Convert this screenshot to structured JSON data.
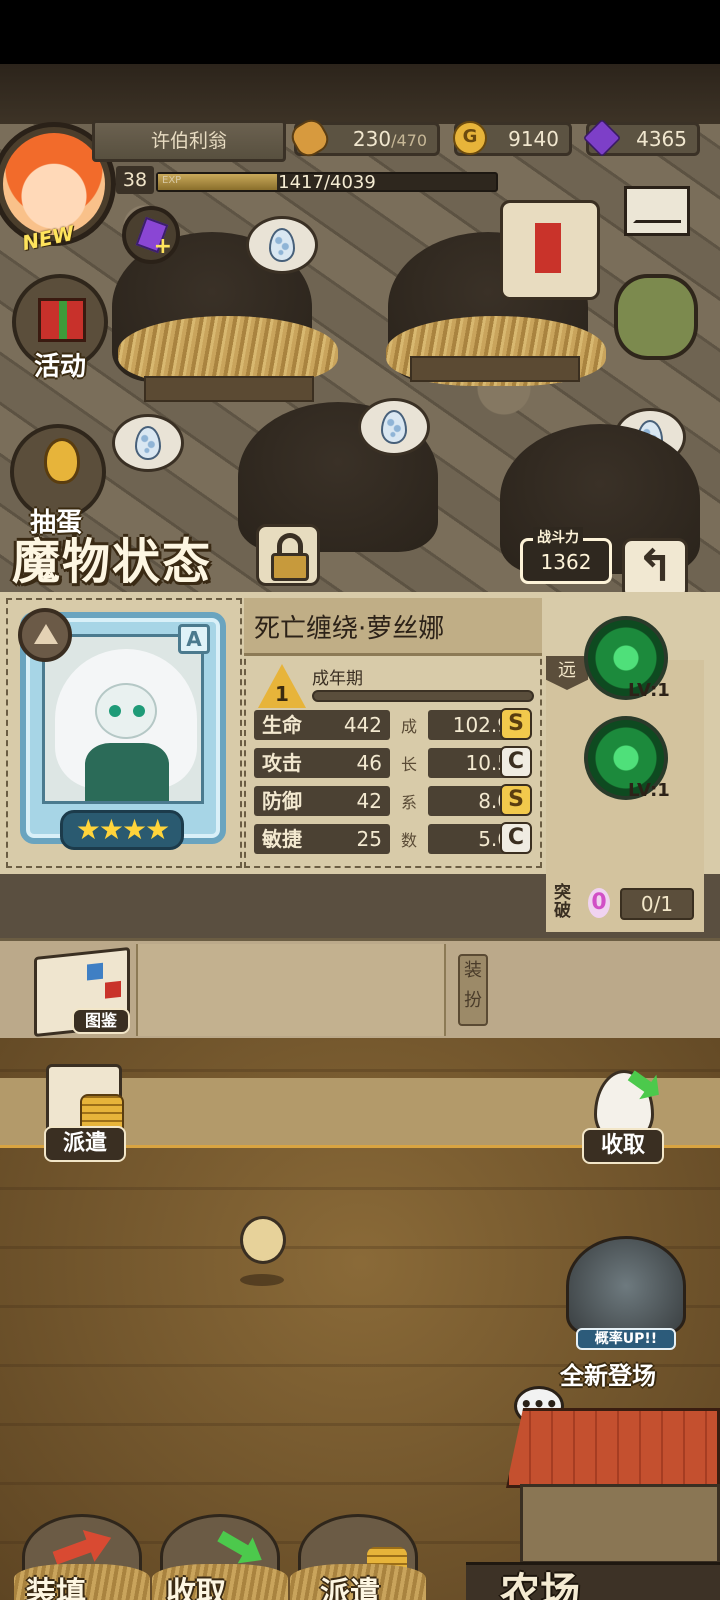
{
  "hud": {
    "player_name": "许伯利翁",
    "avatar_tag": "NEW",
    "level": "38",
    "exp_label": "EXP",
    "exp_text": "1417/4039",
    "exp_progress": 0.351,
    "food_current": "230",
    "food_max": "/470",
    "gold_icon_letter": "G",
    "gold": "9140",
    "gems": "4365"
  },
  "side": {
    "event_label": "活动",
    "egg_label": "抽蛋"
  },
  "panel": {
    "title": "魔物状态",
    "power_label": "战斗力",
    "power_value": "1362",
    "back_icon": "↰",
    "monster_name": "死亡缠绕·萝丝娜",
    "rank": "A",
    "stars": "★★★★",
    "star_count": 4,
    "stage_number": "1",
    "stage_name": "成年期",
    "growth_vertical": [
      "成",
      "长",
      "系",
      "数"
    ],
    "stats": [
      {
        "key": "生命",
        "value": "442",
        "growth": "102.9",
        "grade": "S"
      },
      {
        "key": "攻击",
        "value": "46",
        "growth": "10.5",
        "grade": "C"
      },
      {
        "key": "防御",
        "value": "42",
        "growth": "8.0",
        "grade": "S"
      },
      {
        "key": "敏捷",
        "value": "25",
        "growth": "5.6",
        "grade": "C"
      }
    ],
    "range": "远",
    "skills": [
      {
        "level": "LV:1"
      },
      {
        "level": "LV:1"
      }
    ],
    "breakthrough_label": "突破",
    "breakthrough_value": "0",
    "breakthrough_count": "0/1"
  },
  "shelf": {
    "codex_label": "图鉴",
    "equip_label": "装扮"
  },
  "farm": {
    "dispatch_label": "派遣",
    "collect_label": "收取",
    "gacha_up": "概率UP!!",
    "gacha_label": "全新登场",
    "speech": "•••",
    "farm_label": "农场"
  },
  "bottom": {
    "load_label": "装填",
    "collect_label": "收取",
    "dispatch_label": "派遣"
  }
}
